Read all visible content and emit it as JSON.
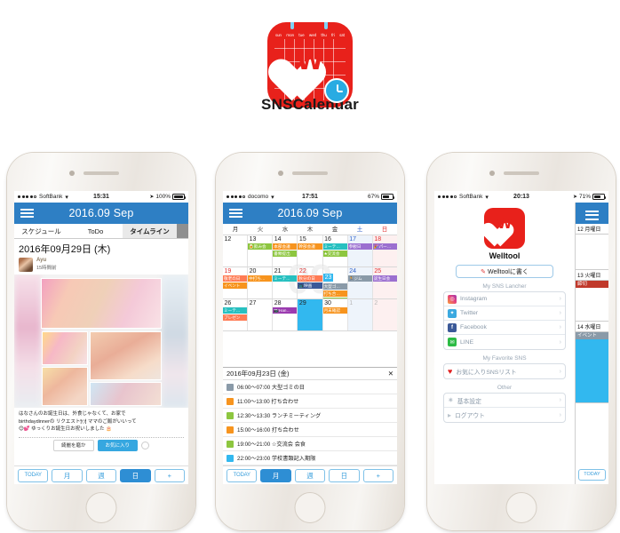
{
  "app": {
    "name": "SNSCalendar",
    "icon_name": "snscalendar-app-icon",
    "icon_weekdays": [
      "sun",
      "mon",
      "tue",
      "wed",
      "thu",
      "fri",
      "sat"
    ],
    "icon_letter": "W"
  },
  "phone1": {
    "status": {
      "carrier": "SoftBank",
      "time": "15:31",
      "battery": "100%"
    },
    "nav": {
      "title": "2016.09 Sep",
      "menu_icon": "hamburger-icon"
    },
    "tabs": [
      {
        "label": "スケジュール",
        "active": false
      },
      {
        "label": "ToDo",
        "active": false
      },
      {
        "label": "タイムライン",
        "active": true
      }
    ],
    "timeline": {
      "date": "2016年09月29日 (木)",
      "author": "Ayu",
      "posted": "15時間前",
      "caption_line1": "はなさんのお誕生日は、外食じゃなくて、お家で",
      "caption_line2": "birthdaydinnerの リクエスト🍽 ママのご飯がいいって",
      "caption_line3": "😊💕 ゆっくりお誕生日お祝いしました 🎂",
      "action_left": "綺麗を磨か",
      "action_right": "お気に入り"
    },
    "toolbar": [
      {
        "label": "TODAY",
        "selected": false
      },
      {
        "label": "月",
        "selected": false
      },
      {
        "label": "週",
        "selected": false
      },
      {
        "label": "日",
        "selected": true
      },
      {
        "label": "+",
        "selected": false
      }
    ]
  },
  "phone2": {
    "status": {
      "carrier": "docomo",
      "time": "17:51",
      "battery": "67%"
    },
    "nav": {
      "title": "2016.09 Sep",
      "menu_icon": "hamburger-icon"
    },
    "weekdays": [
      "月",
      "火",
      "水",
      "木",
      "金",
      "土",
      "日"
    ],
    "watermark": "09",
    "weeks": [
      [
        {
          "day": "12",
          "kind": "normal",
          "events": []
        },
        {
          "day": "13",
          "kind": "normal",
          "events": [
            {
              "text": "🍺飲み会",
              "color": "#8dc63f"
            }
          ]
        },
        {
          "day": "14",
          "kind": "normal",
          "events": [
            {
              "text": "本部会議",
              "color": "#f7941e"
            },
            {
              "text": "書類提出",
              "color": "#8dc63f"
            }
          ]
        },
        {
          "day": "15",
          "kind": "normal",
          "events": [
            {
              "text": "幹部会議",
              "color": "#f7941e"
            }
          ]
        },
        {
          "day": "16",
          "kind": "normal",
          "events": [
            {
              "text": "ミーテ…",
              "color": "#27c0c0"
            },
            {
              "text": "★交流会",
              "color": "#8dc63f"
            }
          ]
        },
        {
          "day": "17",
          "kind": "sat",
          "events": [
            {
              "text": "参観日",
              "color": "#9b6fd0"
            }
          ]
        },
        {
          "day": "18",
          "kind": "sun",
          "events": [
            {
              "text": "🎉パー…",
              "color": "#9b6fd0"
            }
          ]
        }
      ],
      [
        {
          "day": "19",
          "kind": "hol",
          "events": [
            {
              "text": "敬老の日",
              "color": "#ff7b54"
            },
            {
              "text": "イベント",
              "color": "#f7941e"
            }
          ]
        },
        {
          "day": "20",
          "kind": "normal",
          "events": [
            {
              "text": "中打ち…",
              "color": "#f7941e"
            }
          ]
        },
        {
          "day": "21",
          "kind": "normal",
          "events": [
            {
              "text": "ミーテ…",
              "color": "#27c0c0"
            }
          ]
        },
        {
          "day": "22",
          "kind": "hol",
          "events": [
            {
              "text": "秋分の日",
              "color": "#ff7b54"
            },
            {
              "text": "📺映画",
              "color": "#3b5998"
            }
          ]
        },
        {
          "day": "23",
          "kind": "selected",
          "events": [
            {
              "text": "大型ゴ…",
              "color": "#8a9aa8"
            },
            {
              "text": "打ち合…",
              "color": "#f7941e"
            },
            {
              "text": "ランチ…",
              "color": "#8dc63f"
            },
            {
              "text": "打ち合…",
              "color": "#f7941e"
            }
          ]
        },
        {
          "day": "24",
          "kind": "sat",
          "events": [
            {
              "text": "🏃ジム",
              "color": "#8a9aa8"
            }
          ]
        },
        {
          "day": "25",
          "kind": "sun",
          "events": [
            {
              "text": "誕生日会",
              "color": "#9b6fd0"
            }
          ]
        }
      ],
      [
        {
          "day": "26",
          "kind": "normal",
          "events": [
            {
              "text": "ミーテ…",
              "color": "#27c0c0"
            },
            {
              "text": "プレゼン",
              "color": "#ff7b54"
            }
          ]
        },
        {
          "day": "27",
          "kind": "normal",
          "events": []
        },
        {
          "day": "28",
          "kind": "normal",
          "events": [
            {
              "text": "📷Han…",
              "color": "#9b3bb0"
            }
          ]
        },
        {
          "day": "29",
          "kind": "selected-fill",
          "events": []
        },
        {
          "day": "30",
          "kind": "normal",
          "events": [
            {
              "text": "月末確認",
              "color": "#f7941e"
            }
          ]
        },
        {
          "day": "1",
          "kind": "other-sat",
          "events": []
        },
        {
          "day": "2",
          "kind": "other-sun",
          "events": []
        }
      ]
    ],
    "sheet": {
      "date": "2016年09月23日 (金)",
      "close_icon": "close-icon",
      "events": [
        {
          "time": "06:00〜07:00",
          "title": "大型ゴミの日",
          "color": "#8a9aa8"
        },
        {
          "time": "11:00〜13:00",
          "title": "打ち合わせ",
          "color": "#f7941e"
        },
        {
          "time": "12:30〜13:30",
          "title": "ランチミーティング",
          "color": "#8dc63f"
        },
        {
          "time": "15:00〜16:00",
          "title": "打ち合わせ",
          "color": "#f7941e"
        },
        {
          "time": "19:00〜21:00",
          "title": "☆交流会 会食",
          "color": "#8dc63f"
        },
        {
          "time": "22:00〜23:00",
          "title": "学校書類記入期限",
          "color": "#32b8ef"
        }
      ]
    },
    "toolbar": [
      {
        "label": "TODAY",
        "selected": false
      },
      {
        "label": "月",
        "selected": true
      },
      {
        "label": "週",
        "selected": false
      },
      {
        "label": "日",
        "selected": false
      },
      {
        "label": "+",
        "selected": false
      }
    ]
  },
  "phone3": {
    "status": {
      "carrier": "SoftBank",
      "time": "20:13",
      "battery": "71%"
    },
    "brand": {
      "name": "Welltool",
      "letter": "W",
      "logo_name": "welltool-logo"
    },
    "write_button": {
      "label": "Welltoolに書く",
      "icon": "pencil-icon"
    },
    "sections": [
      {
        "title": "My SNS Lancher",
        "items": [
          {
            "label": "Instagram",
            "icon": "instagram-icon",
            "glyph": "◉"
          },
          {
            "label": "Twitter",
            "icon": "twitter-icon",
            "glyph": "✦"
          },
          {
            "label": "Facebook",
            "icon": "facebook-icon",
            "glyph": "f"
          },
          {
            "label": "LINE",
            "icon": "line-icon",
            "glyph": "✉"
          }
        ]
      },
      {
        "title": "My Favorite SNS",
        "items": [
          {
            "label": "お気に入りSNSリスト",
            "icon": "heart-icon",
            "glyph": "♥"
          }
        ]
      },
      {
        "title": "Other",
        "items": [
          {
            "label": "基本設定",
            "icon": "gear-icon",
            "glyph": "✷"
          },
          {
            "label": "ログアウト",
            "icon": "logout-icon",
            "glyph": "▐"
          }
        ]
      }
    ],
    "peek": {
      "menu_icon": "hamburger-icon",
      "days": [
        {
          "label": "12 月曜日",
          "event": "",
          "event_color": "",
          "fill": ""
        },
        {
          "label": "13 火曜日",
          "event": "締切",
          "event_color": "#c0392b",
          "fill": ""
        },
        {
          "label": "14 水曜日",
          "event": "イベント",
          "event_color": "#8a9aa8",
          "fill": "#32b8ef"
        }
      ],
      "today_label": "TODAY"
    }
  }
}
